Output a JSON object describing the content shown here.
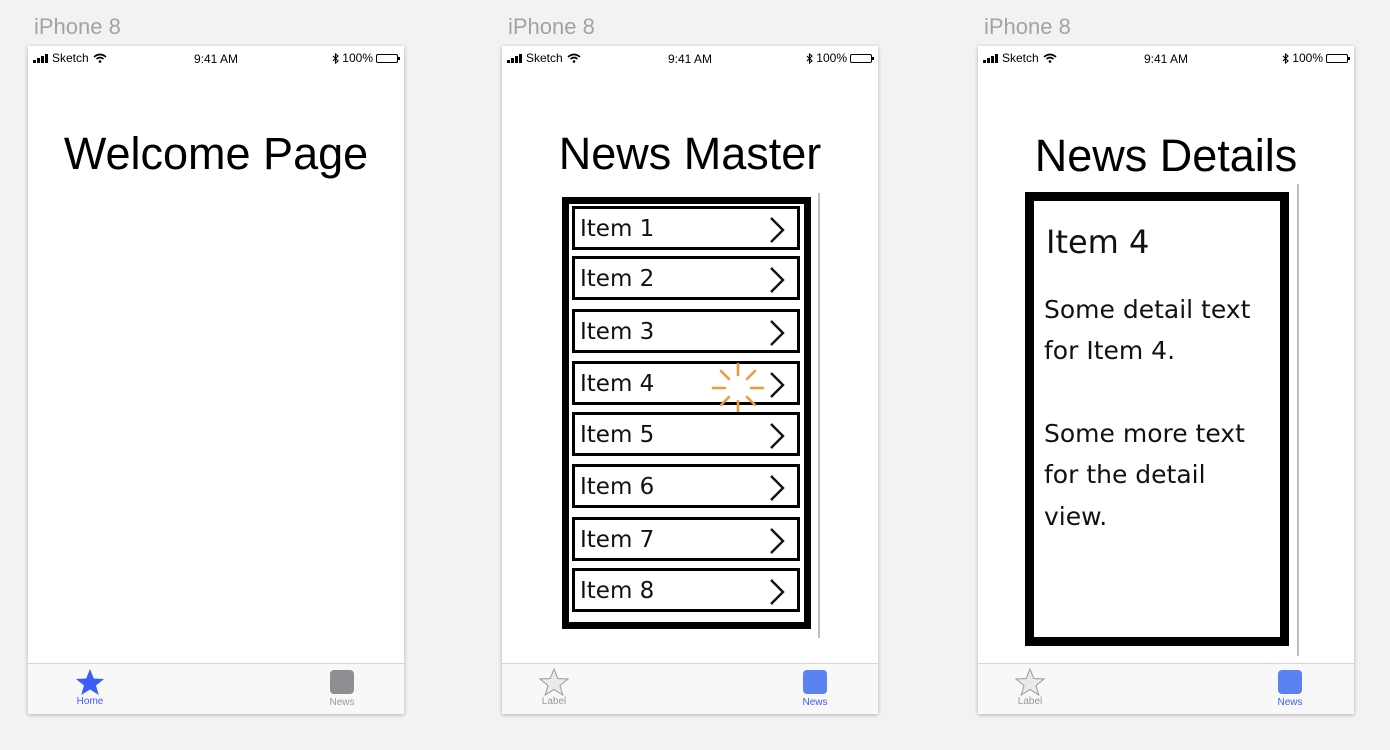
{
  "artboards": [
    {
      "label": "iPhone 8",
      "status": {
        "carrier": "Sketch",
        "time": "9:41 AM",
        "battery": "100%"
      },
      "title": "Welcome Page",
      "tabs": [
        {
          "label": "Home",
          "icon": "star-filled-icon",
          "active": true
        },
        {
          "label": "News",
          "icon": "square-icon",
          "active": false
        }
      ]
    },
    {
      "label": "iPhone 8",
      "status": {
        "carrier": "Sketch",
        "time": "9:41 AM",
        "battery": "100%"
      },
      "title": "News Master",
      "list_items": [
        "Item 1",
        "Item 2",
        "Item 3",
        "Item 4",
        "Item 5",
        "Item 6",
        "Item 7",
        "Item 8"
      ],
      "tabs": [
        {
          "label": "Label",
          "icon": "star-outline-icon",
          "active": false
        },
        {
          "label": "News",
          "icon": "square-icon",
          "active": true
        }
      ]
    },
    {
      "label": "iPhone 8",
      "status": {
        "carrier": "Sketch",
        "time": "9:41 AM",
        "battery": "100%"
      },
      "title": "News Details",
      "detail": {
        "heading": "Item 4",
        "line1": "Some detail text",
        "line2": "for Item 4.",
        "line3": "Some more text",
        "line4": "for the detail",
        "line5": "view."
      },
      "tabs": [
        {
          "label": "Label",
          "icon": "star-outline-icon",
          "active": false
        },
        {
          "label": "News",
          "icon": "square-icon",
          "active": true
        }
      ]
    }
  ],
  "colors": {
    "active_tab": "#3b5ef7",
    "inactive_tab": "#999999",
    "active_square": "#5a82f0",
    "inactive_square": "#8e8e93",
    "tap_indicator": "#ef9a3c",
    "canvas_bg": "#f2f2f2"
  }
}
